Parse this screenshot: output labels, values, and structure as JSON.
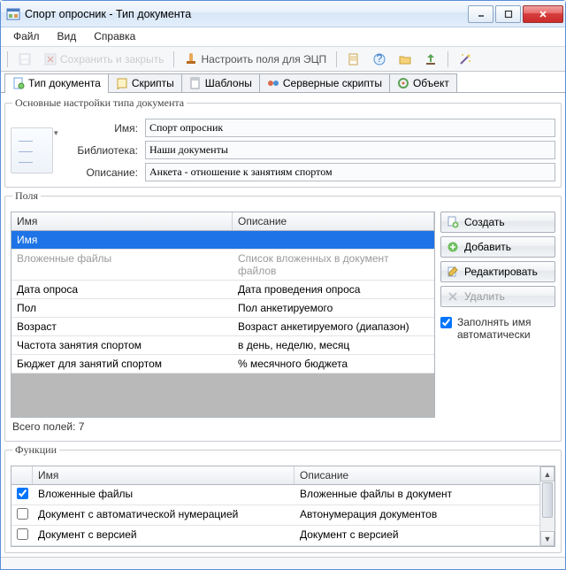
{
  "window": {
    "title": "Спорт опросник - Тип документа"
  },
  "menu": {
    "file": "Файл",
    "view": "Вид",
    "help": "Справка"
  },
  "toolbar": {
    "save_close": "Сохранить и закрыть",
    "config_sig": "Настроить поля для ЭЦП"
  },
  "tabs": {
    "doc_type": "Тип документа",
    "scripts": "Скрипты",
    "templates": "Шаблоны",
    "server_scripts": "Серверные скрипты",
    "object": "Объект"
  },
  "settings": {
    "group": "Основные настройки типа документа",
    "labels": {
      "name": "Имя:",
      "library": "Библиотека:",
      "description": "Описание:"
    },
    "values": {
      "name": "Спорт опросник",
      "library": "Наши документы",
      "description": "Анкета - отношение к занятиям спортом"
    }
  },
  "fields": {
    "group": "Поля",
    "headers": {
      "name": "Имя",
      "desc": "Описание"
    },
    "rows": [
      {
        "name": "Имя",
        "desc": "",
        "selected": true
      },
      {
        "name": "Вложенные файлы",
        "desc": "Список вложенных в документ файлов",
        "embedded": true
      },
      {
        "name": "Дата опроса",
        "desc": "Дата проведения опроса"
      },
      {
        "name": "Пол",
        "desc": "Пол анкетируемого"
      },
      {
        "name": "Возраст",
        "desc": "Возраст анкетируемого (диапазон)"
      },
      {
        "name": "Частота занятия спортом",
        "desc": "в день, неделю, месяц"
      },
      {
        "name": "Бюджет для занятий спортом",
        "desc": "% месячного бюджета"
      }
    ],
    "summary": "Всего полей: 7",
    "buttons": {
      "create": "Создать",
      "add": "Добавить",
      "edit": "Редактировать",
      "delete": "Удалить"
    },
    "checkbox": "Заполнять имя автоматически",
    "checkbox_checked": true
  },
  "functions": {
    "group": "Функции",
    "headers": {
      "name": "Имя",
      "desc": "Описание"
    },
    "rows": [
      {
        "checked": true,
        "name": "Вложенные файлы",
        "desc": "Вложенные файлы в документ"
      },
      {
        "checked": false,
        "name": "Документ с автоматической нумерацией",
        "desc": "Автонумерация документов"
      },
      {
        "checked": false,
        "name": "Документ с версией",
        "desc": "Документ с версией"
      }
    ]
  }
}
